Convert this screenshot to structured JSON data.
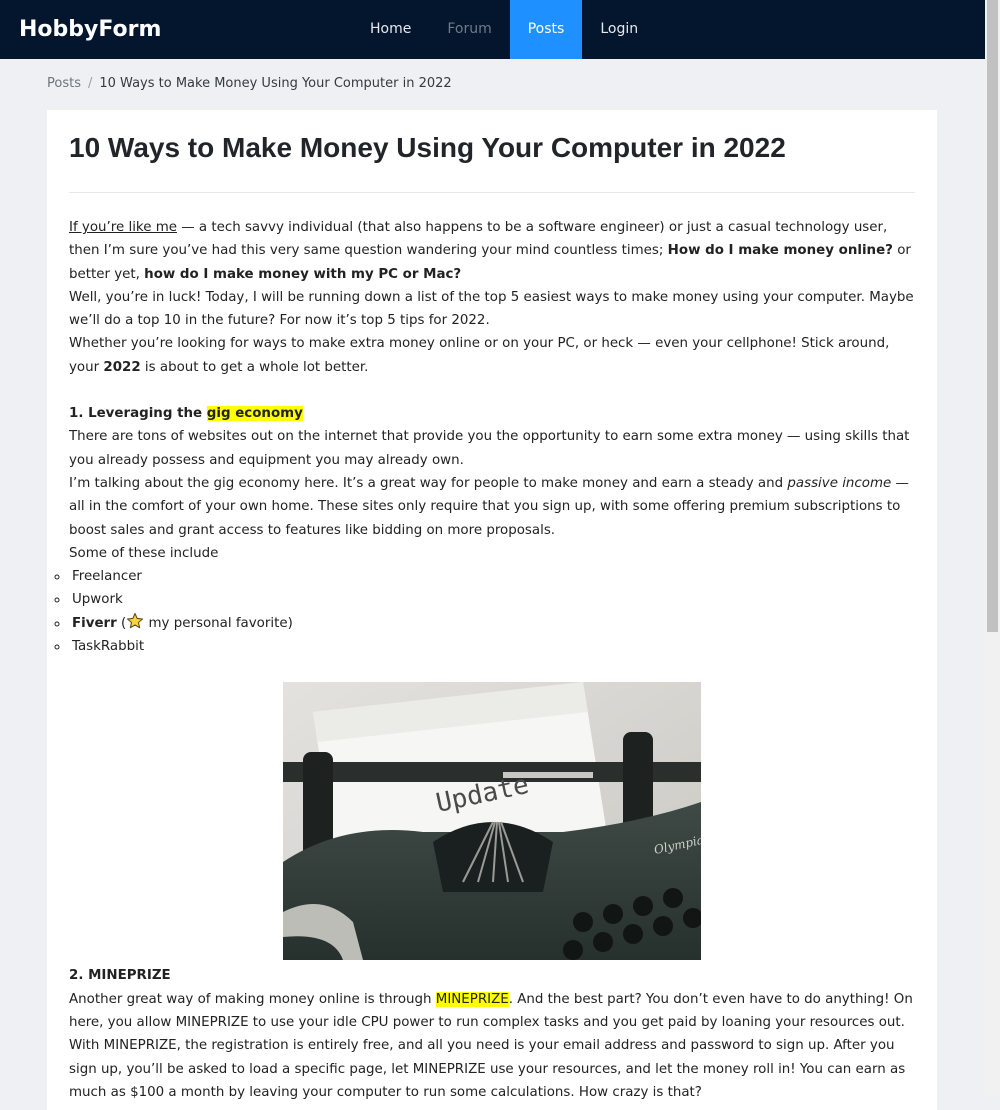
{
  "brand": "HobbyForm",
  "nav": {
    "home": "Home",
    "forum": "Forum",
    "posts": "Posts",
    "login": "Login"
  },
  "breadcrumb": {
    "root": "Posts",
    "separator": "/",
    "current": "10 Ways to Make Money Using Your Computer in 2022"
  },
  "post": {
    "title": "10 Ways to Make Money Using Your Computer in 2022",
    "intro": {
      "link": "If you’re like me",
      "text1": " — a tech savvy individual (that also happens to be a software engineer) or just a casual technology user, then I’m sure you’ve had this very same question wandering your mind countless times; ",
      "bold1": "How do I make money online?",
      "text2": " or better yet, ",
      "bold2": "how do I make money with my PC or Mac?"
    },
    "para2": "Well, you’re in luck! Today, I will be running down a list of the top 5 easiest ways to make money using your computer. Maybe we’ll do a top 10 in the future? For now it’s top 5 tips for 2022.",
    "para3": {
      "text1": "Whether you’re looking for ways to make extra money online or on your PC, or heck — even your cellphone! Stick around, your ",
      "bold": "2022",
      "text2": " is about to get a whole lot better."
    },
    "section1": {
      "heading_prefix": "1. Leveraging the ",
      "heading_highlight": "gig economy",
      "para1": "There are tons of websites out on the internet that provide you the opportunity to earn some extra money — using skills that you already possess and equipment you may already own.",
      "para2_text1": "I’m talking about the gig economy here. It’s a great way for people to make money and earn a steady and ",
      "para2_italic": "passive income",
      "para2_text2": " — all in the comfort of your own home. These sites only require that you sign up, with some offering premium subscriptions to boost sales and grant access to features like bidding on more proposals.",
      "para3": "Some of these include",
      "list": {
        "item1": "Freelancer",
        "item2": "Upwork",
        "item3_bold": "Fiverr",
        "item3_open": " (",
        "item3_rest": " my personal favorite)",
        "item4": "TaskRabbit"
      },
      "image_text": "Update",
      "image_brand": "Olympia"
    },
    "section2": {
      "heading": "2. MINEPRIZE",
      "para1_text1": "Another great way of making money online is through ",
      "para1_highlight": "MINEPRIZE",
      "para1_text2": ". And the best part? You don’t even have to do anything! On here, you allow MINEPRIZE to use your idle CPU power to run complex tasks and you get paid by loaning your resources out.",
      "para2": "With MINEPRIZE, the registration is entirely free, and all you need is your email address and password to sign up. After you sign up, you’ll be asked to load a specific page, let MINEPRIZE use your resources, and let the money roll in! You can earn as much as $100 a month by leaving your computer to run some calculations. How crazy is that?"
    }
  },
  "colors": {
    "navbar": "#04152e",
    "active_tab": "#1e90ff",
    "highlight": "#ffff00",
    "page_bg": "#eef0f3"
  },
  "icons": {
    "star": "star-icon"
  }
}
